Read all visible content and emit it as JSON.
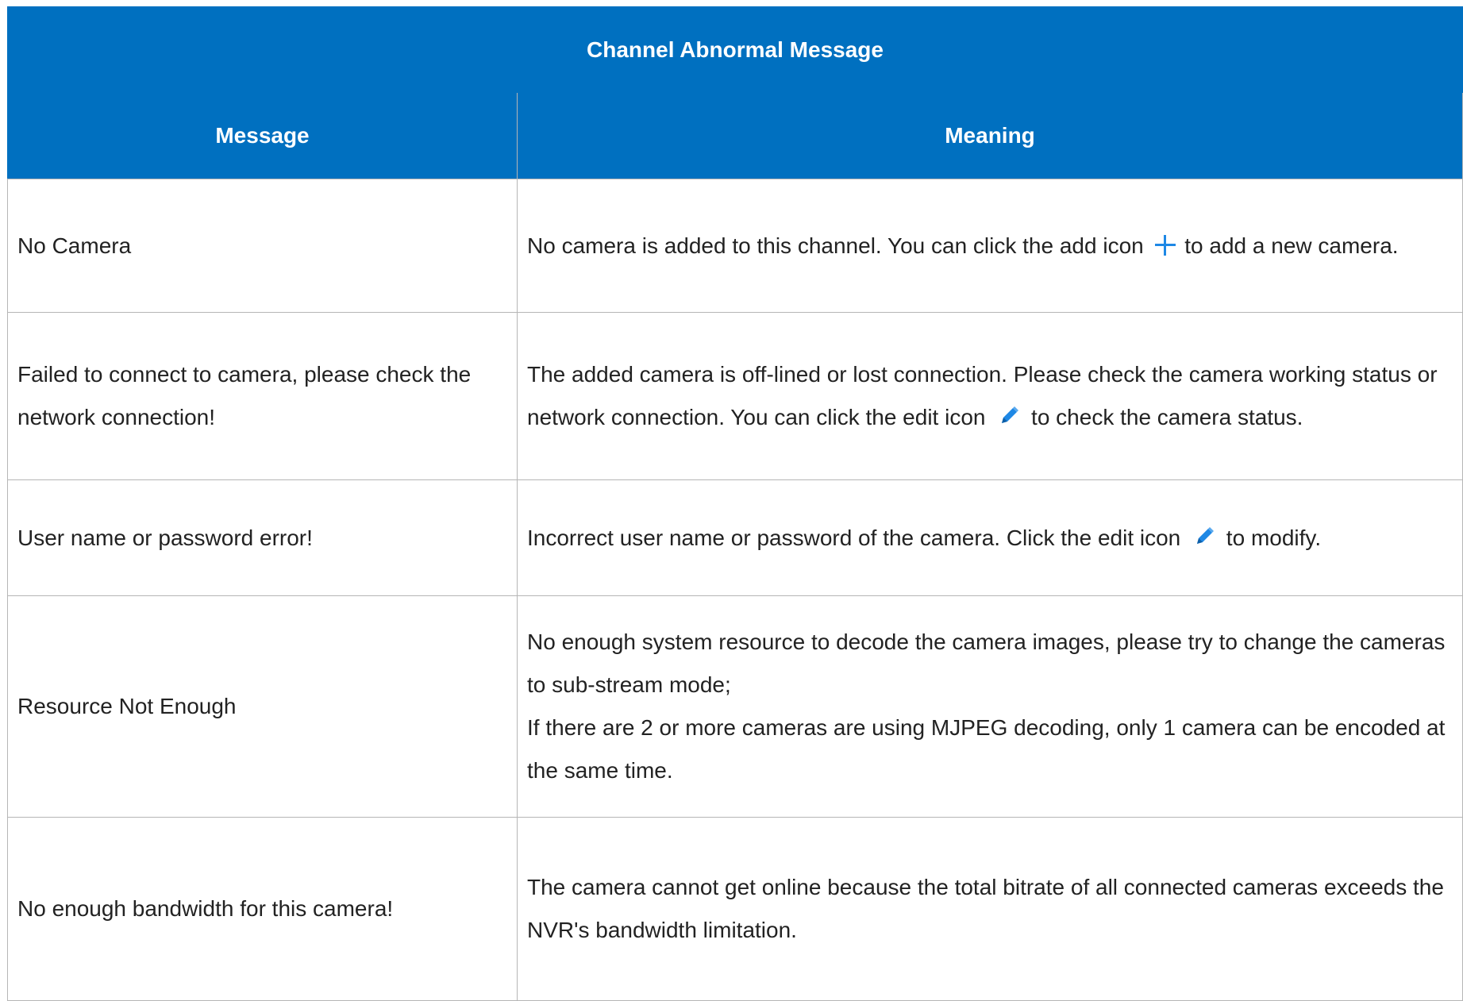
{
  "table": {
    "title": "Channel Abnormal Message",
    "headers": {
      "message": "Message",
      "meaning": "Meaning"
    },
    "rows": [
      {
        "message": "No Camera",
        "meaning_before": "No camera is added to this channel. You can click the add icon",
        "icon": "plus-icon",
        "meaning_after": "to add a new camera."
      },
      {
        "message": "Failed to connect to camera, please check the network connection!",
        "meaning_before": "The added camera is off-lined or lost connection. Please check the camera working status or network connection. You can click the edit icon",
        "icon": "pencil-icon",
        "meaning_after": "to check the camera status."
      },
      {
        "message": "User name or password error!",
        "meaning_before": "Incorrect user name or password of the camera. Click the edit icon",
        "icon": "pencil-icon",
        "meaning_after": "to modify."
      },
      {
        "message": "Resource Not Enough",
        "meaning_line1": "No enough system resource to decode the camera images, please try to change the cameras to sub-stream mode;",
        "meaning_line2": "If there are 2 or more cameras are using MJPEG decoding, only 1 camera can be encoded at the same time."
      },
      {
        "message": "No enough bandwidth for this camera!",
        "meaning": "The camera cannot get online because the total bitrate of all connected cameras exceeds the NVR's bandwidth limitation."
      }
    ]
  },
  "colors": {
    "header_bg": "#0070c0",
    "header_text": "#ffffff",
    "body_text": "#222222",
    "border": "#b6b6b6",
    "icon": "#1e88e5"
  }
}
